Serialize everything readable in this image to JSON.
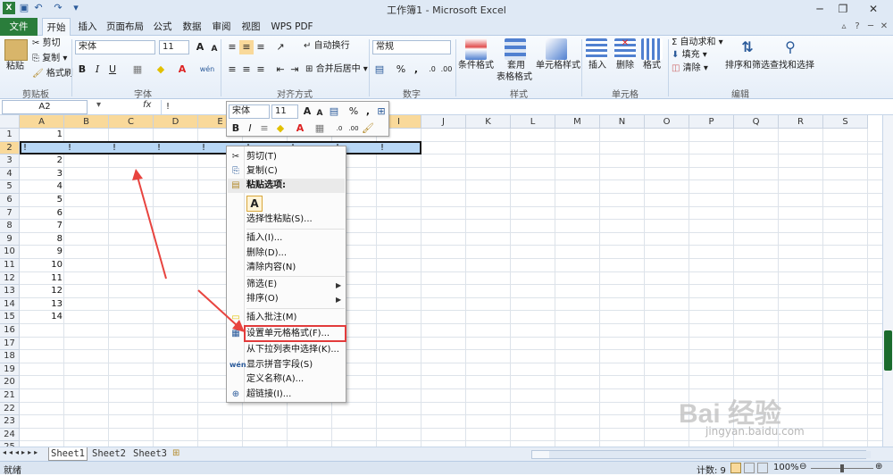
{
  "window": {
    "title": "工作簿1 - Microsoft Excel"
  },
  "tabs": {
    "file": "文件",
    "home": "开始",
    "insert": "插入",
    "layout": "页面布局",
    "formulas": "公式",
    "data": "数据",
    "review": "审阅",
    "view": "视图",
    "wps": "WPS PDF"
  },
  "ribbon": {
    "clipboard": {
      "paste": "粘贴",
      "cut": "剪切",
      "copy": "复制",
      "painter": "格式刷",
      "label": "剪贴板"
    },
    "font": {
      "name": "宋体",
      "size": "11",
      "label": "字体",
      "bold": "B",
      "italic": "I",
      "underline": "U",
      "font_color": "A",
      "size_up": "A",
      "size_down": "A",
      "phonetic": "wén"
    },
    "alignment": {
      "wrap": "自动换行",
      "merge": "合并后居中",
      "label": "对齐方式"
    },
    "number": {
      "format": "常规",
      "percent": "%",
      "comma": ",",
      "label": "数字"
    },
    "styles": {
      "conditional": "条件格式",
      "table1": "套用",
      "table2": "表格格式",
      "cell_styles": "单元格样式",
      "label": "样式"
    },
    "cells": {
      "insert": "插入",
      "delete": "删除",
      "format": "格式",
      "label": "单元格"
    },
    "editing": {
      "autosum": "Σ 自动求和",
      "fill": "填充",
      "clear": "清除",
      "sort": "排序和筛选",
      "find": "查找和选择",
      "label": "编辑"
    }
  },
  "formula_bar": {
    "name_box": "A2",
    "fx": "fx",
    "content": "!"
  },
  "grid": {
    "columns": [
      "A",
      "B",
      "C",
      "D",
      "E",
      "F",
      "G",
      "H",
      "I",
      "J",
      "K",
      "L",
      "M",
      "N",
      "O",
      "P",
      "Q",
      "R",
      "S"
    ],
    "rows": [
      "1",
      "2",
      "3",
      "4",
      "5",
      "6",
      "7",
      "8",
      "9",
      "10",
      "11",
      "12",
      "13",
      "14",
      "15",
      "16",
      "17",
      "18",
      "19",
      "20",
      "21",
      "22",
      "23",
      "24",
      "25"
    ],
    "col_a_values": [
      "1",
      "",
      "2",
      "3",
      "4",
      "5",
      "6",
      "7",
      "8",
      "9",
      "10",
      "11",
      "12",
      "13",
      "14"
    ],
    "row2_values": [
      "!",
      "!",
      "!",
      "!",
      "!",
      "!",
      "!",
      "!",
      "!"
    ]
  },
  "sheets": [
    "Sheet1",
    "Sheet2",
    "Sheet3"
  ],
  "status": {
    "ready": "就绪",
    "count": "计数: 9",
    "zoom": "100%"
  },
  "mini_toolbar": {
    "font": "宋体",
    "size": "11",
    "percent": "%",
    "comma": ","
  },
  "context_menu": {
    "cut": "剪切(T)",
    "copy": "复制(C)",
    "paste_options": "粘贴选项:",
    "paste_a": "A",
    "paste_special": "选择性粘贴(S)...",
    "insert": "插入(I)...",
    "delete": "删除(D)...",
    "clear": "清除内容(N)",
    "filter": "筛选(E)",
    "sort": "排序(O)",
    "comment": "插入批注(M)",
    "format_cells": "设置单元格格式(F)...",
    "pick_list": "从下拉列表中选择(K)...",
    "phonetic": "显示拼音字段(S)",
    "define_name": "定义名称(A)...",
    "hyperlink": "超链接(I)..."
  },
  "watermark": {
    "brand": "Bai 经验",
    "url": "jingyan.baidu.com"
  },
  "colors": {
    "highlight": "#f9d99a",
    "selection": "#b8d7f5",
    "menu_highlight": "#e23b3b",
    "arrow": "#e8443f",
    "file_tab": "#2a7d3b"
  }
}
